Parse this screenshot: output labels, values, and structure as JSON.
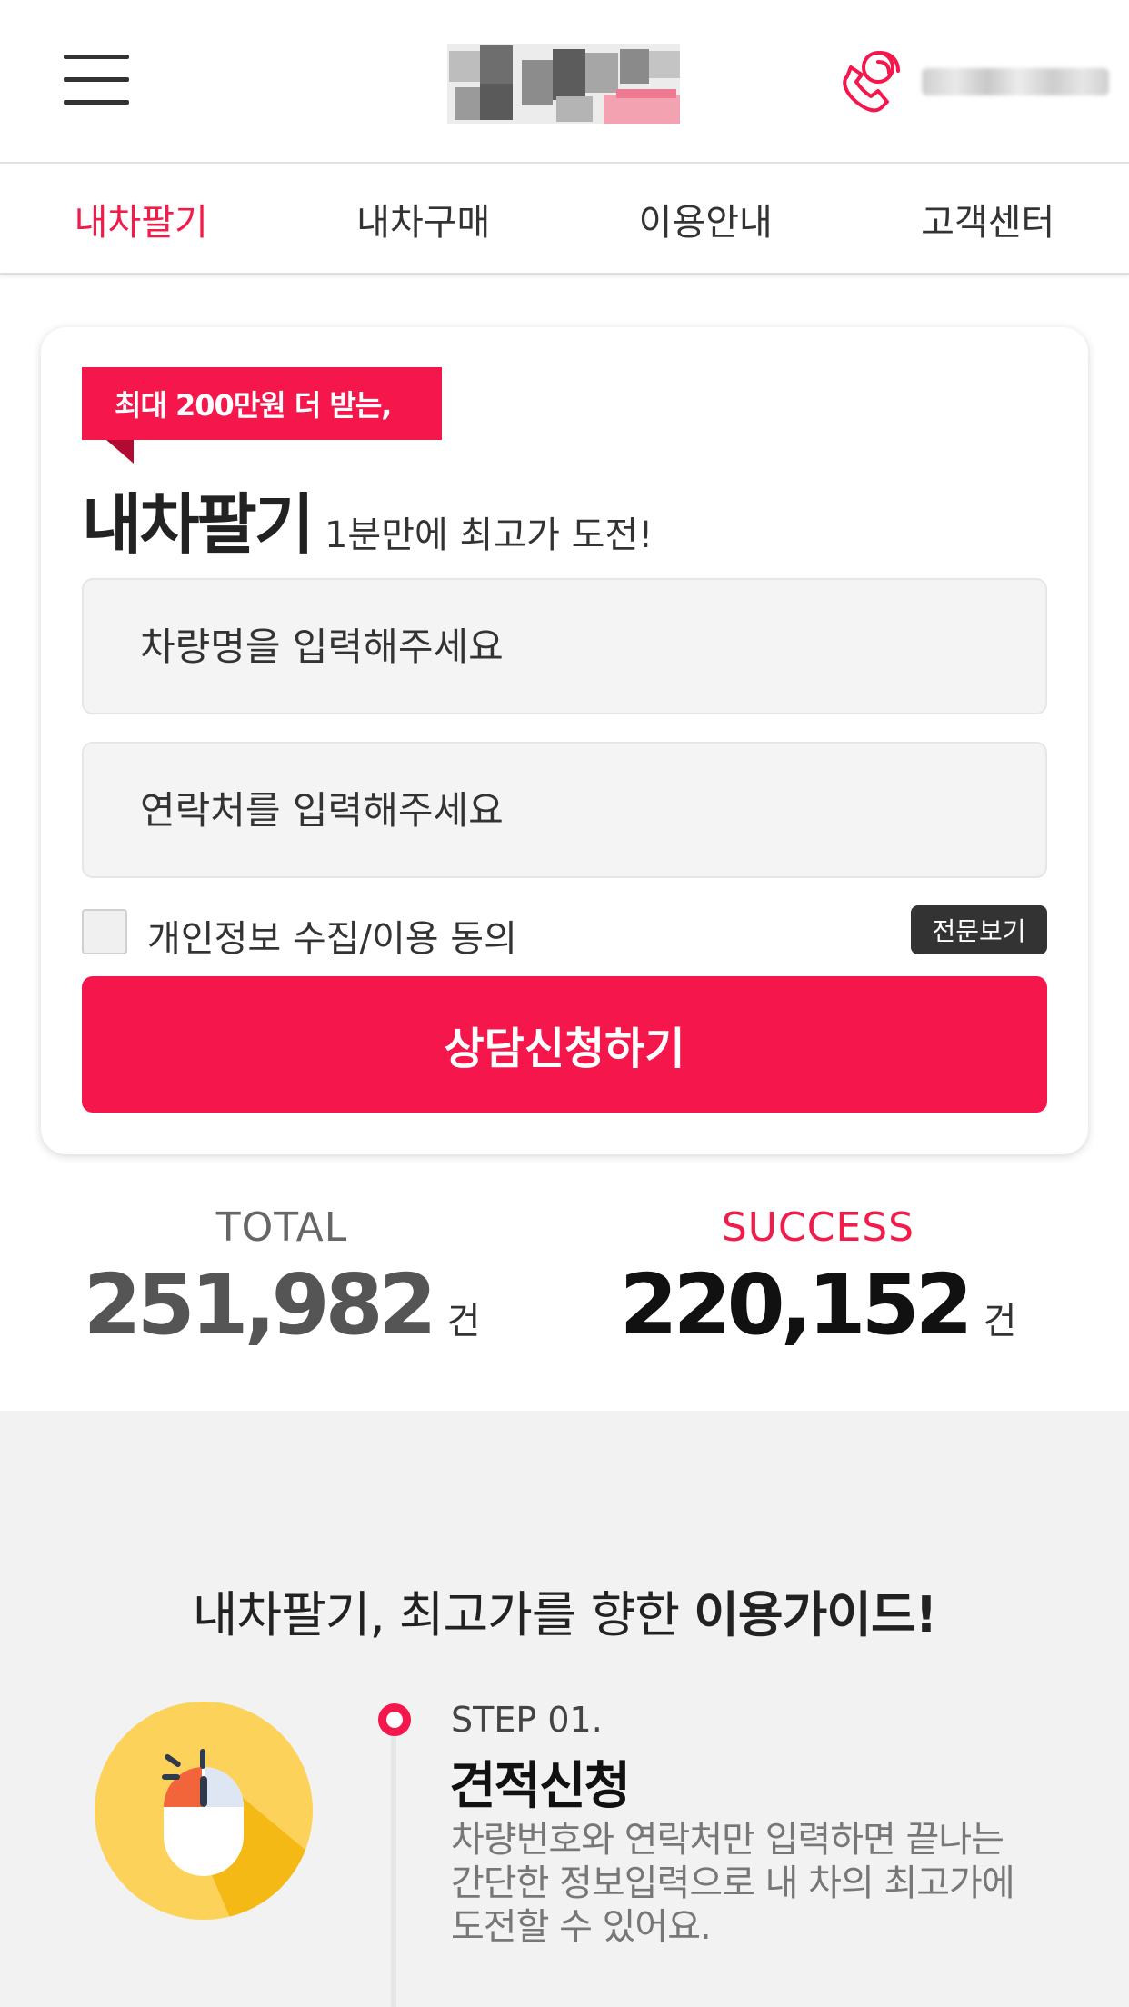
{
  "header": {
    "menu_icon": "hamburger-menu-icon",
    "logo_label": "",
    "phone_icon": "phone-call-icon",
    "accent_color": "#f5164c"
  },
  "nav": {
    "items": [
      {
        "label": "내차팔기",
        "active": true
      },
      {
        "label": "내차구매",
        "active": false
      },
      {
        "label": "이용안내",
        "active": false
      },
      {
        "label": "고객센터",
        "active": false
      }
    ]
  },
  "form": {
    "ribbon": "최대 200만원 더 받는,",
    "title": "내차팔기",
    "subtitle": "1분만에 최고가 도전!",
    "car_name_placeholder": "차량명을 입력해주세요",
    "contact_placeholder": "연락처를 입력해주세요",
    "agree_label": "개인정보 수집/이용 동의",
    "agree_checked": false,
    "view_full_label": "전문보기",
    "submit_label": "상담신청하기"
  },
  "stats": {
    "total_label": "TOTAL",
    "total_value": "251,982",
    "total_unit": "건",
    "success_label": "SUCCESS",
    "success_value": "220,152",
    "success_unit": "건"
  },
  "guide": {
    "title_prefix": "내차팔기, 최고가를 향한 ",
    "title_bold": "이용가이드!",
    "step": {
      "icon": "mouse-click-icon",
      "number": "STEP 01.",
      "title": "견적신청",
      "desc_lines": [
        "차량번호와 연락처만 입력하면 끝나는",
        "간단한 정보입력으로 내 차의 최고가에",
        "도전할 수 있어요."
      ]
    }
  }
}
